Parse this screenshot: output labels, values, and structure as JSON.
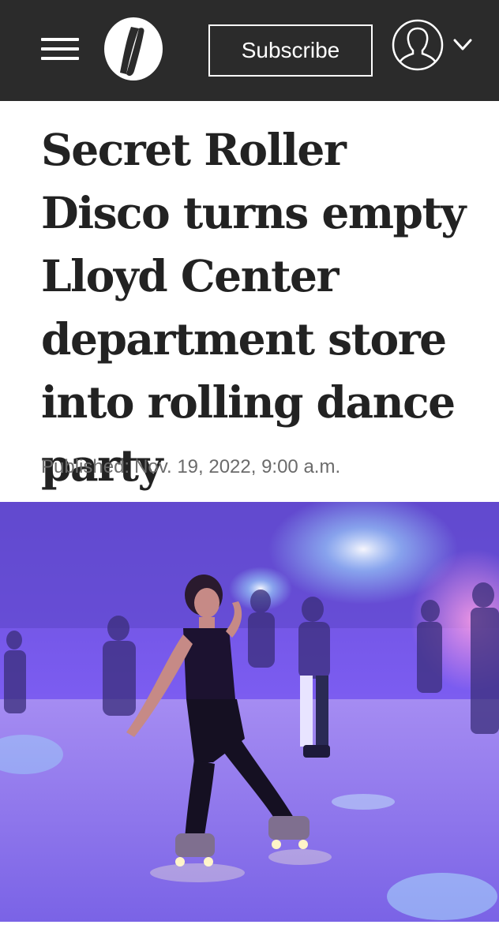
{
  "header": {
    "menu_icon": "hamburger-menu-icon",
    "logo_icon": "oregonian-o-logo",
    "subscribe_label": "Subscribe",
    "account_icon": "user-avatar-icon",
    "account_chevron_icon": "chevron-down-icon",
    "background_color": "#2b2b2b"
  },
  "article": {
    "headline": "Secret Roller Disco turns empty Lloyd Center department store into rolling dance party",
    "published_label": "Published:",
    "published_date": "Nov. 19, 2022, 9:00 a.m."
  },
  "hero_image": {
    "subject": "roller skater dancing under purple lights"
  }
}
